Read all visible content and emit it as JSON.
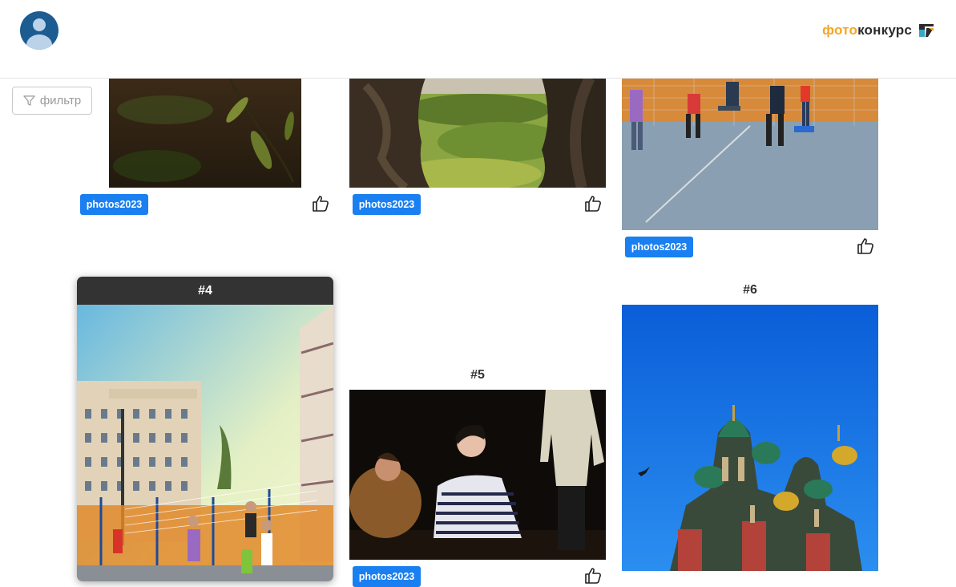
{
  "header": {
    "logo_part1": "фото",
    "logo_part2": "конкурс",
    "avatar": "user-avatar",
    "logo_icon": "logo-mark-icon"
  },
  "filter": {
    "label": "фильтр",
    "icon": "funnel-icon"
  },
  "photos": [
    {
      "tag": "photos2023"
    },
    {
      "tag": "photos2023"
    },
    {
      "tag": "photos2023"
    },
    {
      "number": "#4"
    },
    {
      "number": "#5",
      "tag": "photos2023"
    },
    {
      "number": "#6"
    }
  ],
  "colors": {
    "tag": "#1a7ff0",
    "logo_orange": "#f5a623",
    "card_bar": "#333333"
  }
}
